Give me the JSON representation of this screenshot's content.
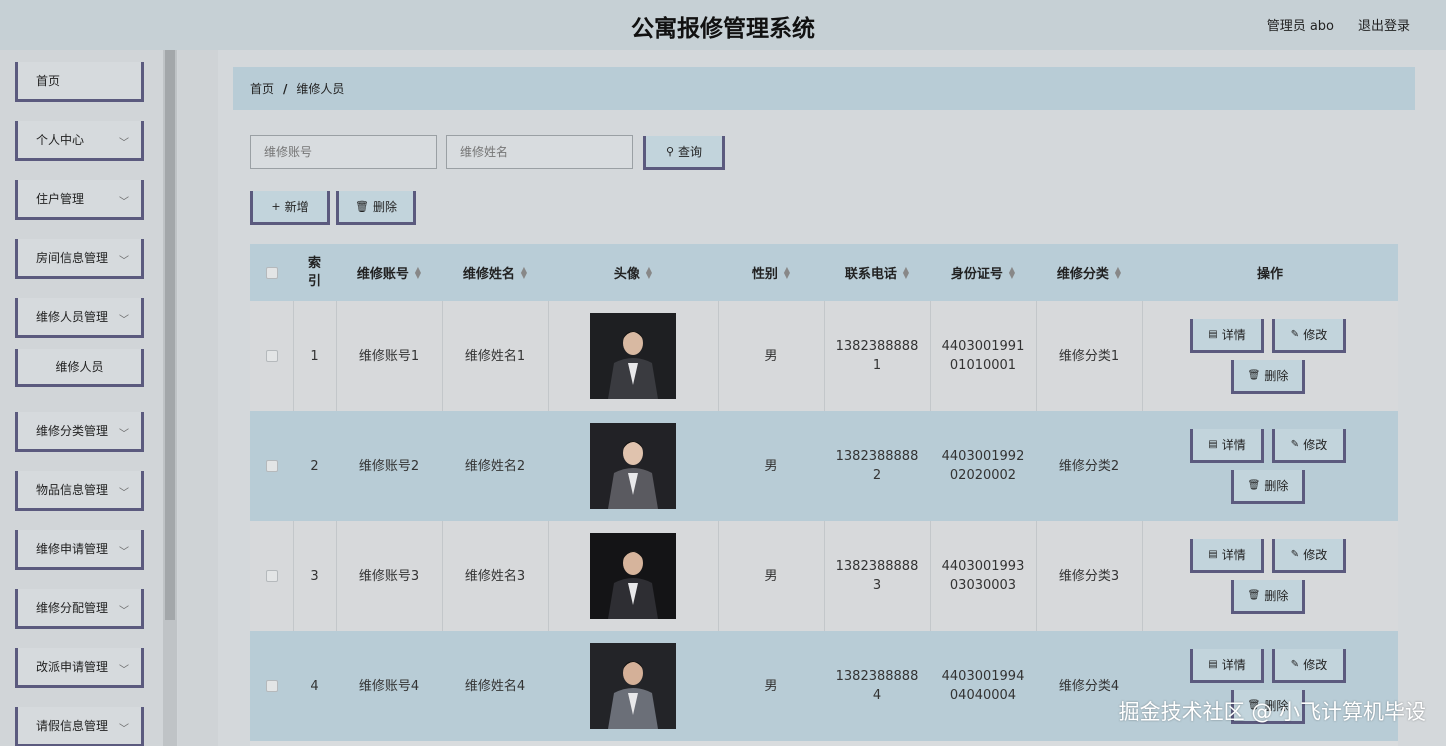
{
  "header": {
    "title": "公寓报修管理系统",
    "user": "管理员 abo",
    "logout": "退出登录"
  },
  "sidebar": {
    "items": [
      {
        "label": "首页"
      },
      {
        "label": "个人中心"
      },
      {
        "label": "住户管理"
      },
      {
        "label": "房间信息管理"
      },
      {
        "label": "维修人员管理"
      },
      {
        "label": "维修人员"
      },
      {
        "label": "维修分类管理"
      },
      {
        "label": "物品信息管理"
      },
      {
        "label": "维修申请管理"
      },
      {
        "label": "维修分配管理"
      },
      {
        "label": "改派申请管理"
      },
      {
        "label": "请假信息管理"
      }
    ]
  },
  "breadcrumb": {
    "home": "首页",
    "sep": "/",
    "current": "维修人员"
  },
  "search": {
    "account_placeholder": "维修账号",
    "name_placeholder": "维修姓名",
    "query_label": "查询"
  },
  "toolbar": {
    "add_label": "新增",
    "delete_label": "删除"
  },
  "table": {
    "headers": {
      "index": "索引",
      "account": "维修账号",
      "name": "维修姓名",
      "avatar": "头像",
      "gender": "性别",
      "phone": "联系电话",
      "id_card": "身份证号",
      "category": "维修分类",
      "action": "操作"
    },
    "rows": [
      {
        "index": "1",
        "account": "维修账号1",
        "name": "维修姓名1",
        "gender": "男",
        "phone": "13823888881",
        "id_card": "440300199101010001",
        "category": "维修分类1"
      },
      {
        "index": "2",
        "account": "维修账号2",
        "name": "维修姓名2",
        "gender": "男",
        "phone": "13823888882",
        "id_card": "440300199202020002",
        "category": "维修分类2"
      },
      {
        "index": "3",
        "account": "维修账号3",
        "name": "维修姓名3",
        "gender": "男",
        "phone": "13823888883",
        "id_card": "440300199303030003",
        "category": "维修分类3"
      },
      {
        "index": "4",
        "account": "维修账号4",
        "name": "维修姓名4",
        "gender": "男",
        "phone": "13823888884",
        "id_card": "440300199404040004",
        "category": "维修分类4"
      }
    ],
    "actions": {
      "detail": "详情",
      "edit": "修改",
      "delete": "删除"
    }
  },
  "watermark": "掘金技术社区 @ 小飞计算机毕设",
  "colors": {
    "accent_border": "#5b5a7e",
    "header_bg": "#b9cdd7"
  }
}
